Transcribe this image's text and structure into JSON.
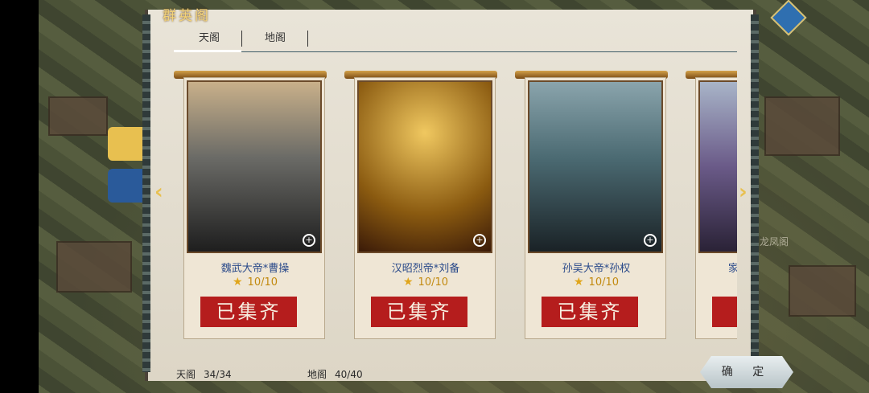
{
  "window": {
    "title": "群英阁"
  },
  "tabs": [
    {
      "label": "天阁",
      "active": true
    },
    {
      "label": "地阁",
      "active": false
    }
  ],
  "cards": [
    {
      "name": "魏武大帝*曹操",
      "count": "10/10",
      "stamp": "已集齐",
      "bg": "#6a6a66"
    },
    {
      "name": "汉昭烈帝*刘备",
      "count": "10/10",
      "stamp": "已集齐",
      "bg": "#b98a2a"
    },
    {
      "name": "孙吴大帝*孙权",
      "count": "10/10",
      "stamp": "已集齐",
      "bg": "#4b6a72"
    },
    {
      "name": "家",
      "count": "",
      "stamp": "已",
      "bg": "#6a5a88"
    }
  ],
  "footer": {
    "tian_label": "天阁",
    "tian_value": "34/34",
    "di_label": "地阁",
    "di_value": "40/40"
  },
  "buttons": {
    "confirm": "确 定"
  },
  "map": {
    "label": "龙凤阁"
  },
  "colors": {
    "stamp_red": "#b51d1d",
    "title_gold": "#f2d27a",
    "name_blue": "#2a4a8a"
  }
}
